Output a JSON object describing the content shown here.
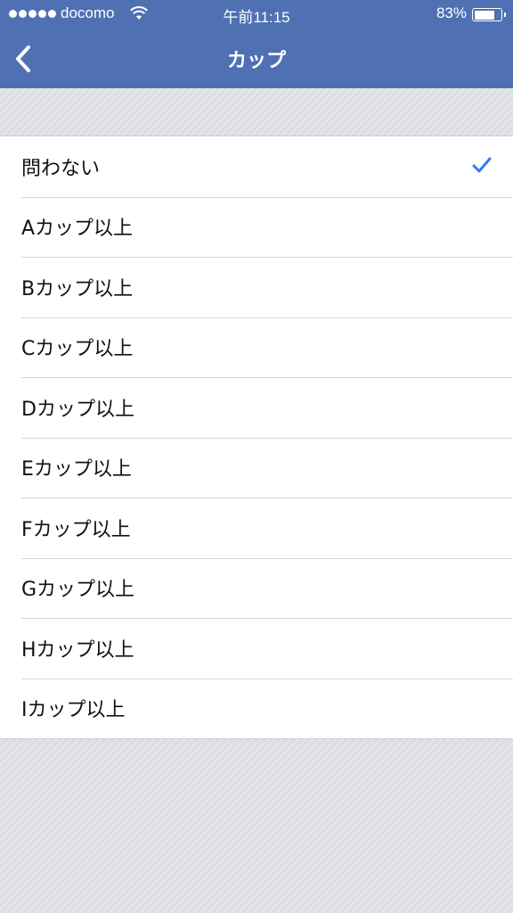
{
  "status_bar": {
    "carrier": "docomo",
    "time": "午前11:15",
    "battery_pct": "83%",
    "battery_level": 0.83,
    "signal_bars": 5
  },
  "nav": {
    "title": "カップ",
    "back_icon": "chevron-left-icon"
  },
  "options": [
    {
      "label": "問わない",
      "selected": true
    },
    {
      "label": "Aカップ以上",
      "selected": false
    },
    {
      "label": "Bカップ以上",
      "selected": false
    },
    {
      "label": "Cカップ以上",
      "selected": false
    },
    {
      "label": "Dカップ以上",
      "selected": false
    },
    {
      "label": "Eカップ以上",
      "selected": false
    },
    {
      "label": "Fカップ以上",
      "selected": false
    },
    {
      "label": "Gカップ以上",
      "selected": false
    },
    {
      "label": "Hカップ以上",
      "selected": false
    },
    {
      "label": "Iカップ以上",
      "selected": false
    }
  ],
  "colors": {
    "header": "#4f71b3",
    "check": "#3478f6",
    "background": "#dcdee3"
  }
}
